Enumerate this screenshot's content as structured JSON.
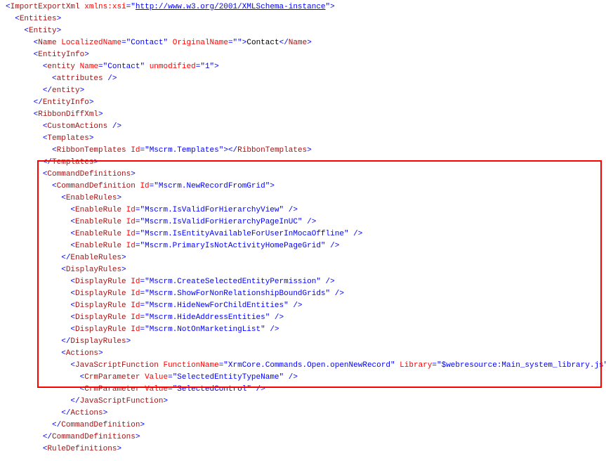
{
  "root": {
    "tag": "ImportExportXml",
    "attrs": [
      [
        "xmlns:xsi",
        "http://www.w3.org/2001/XMLSchema-instance"
      ]
    ]
  },
  "entities_tag": {
    "tag": "Entities"
  },
  "entity_tag": {
    "tag": "Entity"
  },
  "name": {
    "tag": "Name",
    "attrs": [
      [
        "LocalizedName",
        "Contact"
      ],
      [
        "OriginalName",
        ""
      ]
    ],
    "text": "Contact"
  },
  "entityinfo_tag": {
    "tag": "EntityInfo"
  },
  "entity_inner": {
    "tag": "entity",
    "attrs": [
      [
        "Name",
        "Contact"
      ],
      [
        "unmodified",
        "1"
      ]
    ]
  },
  "attributes_tag": {
    "tag": "attributes"
  },
  "ribbon_tag": {
    "tag": "RibbonDiffXml"
  },
  "custom_tag": {
    "tag": "CustomActions"
  },
  "templates_tag": {
    "tag": "Templates"
  },
  "ribbontemplates": {
    "tag": "RibbonTemplates",
    "attrs": [
      [
        "Id",
        "Mscrm.Templates"
      ]
    ]
  },
  "cmddefs_tag": {
    "tag": "CommandDefinitions"
  },
  "cmddef": {
    "tag": "CommandDefinition",
    "attrs": [
      [
        "Id",
        "Mscrm.NewRecordFromGrid"
      ]
    ]
  },
  "enablerules_tag": {
    "tag": "EnableRules"
  },
  "enable_rules": [
    {
      "tag": "EnableRule",
      "attrs": [
        [
          "Id",
          "Mscrm.IsValidForHierarchyView"
        ]
      ]
    },
    {
      "tag": "EnableRule",
      "attrs": [
        [
          "Id",
          "Mscrm.IsValidForHierarchyPageInUC"
        ]
      ]
    },
    {
      "tag": "EnableRule",
      "attrs": [
        [
          "Id",
          "Mscrm.IsEntityAvailableForUserInMocaOffline"
        ]
      ]
    },
    {
      "tag": "EnableRule",
      "attrs": [
        [
          "Id",
          "Mscrm.PrimaryIsNotActivityHomePageGrid"
        ]
      ]
    }
  ],
  "displayrules_tag": {
    "tag": "DisplayRules"
  },
  "display_rules": [
    {
      "tag": "DisplayRule",
      "attrs": [
        [
          "Id",
          "Mscrm.CreateSelectedEntityPermission"
        ]
      ]
    },
    {
      "tag": "DisplayRule",
      "attrs": [
        [
          "Id",
          "Mscrm.ShowForNonRelationshipBoundGrids"
        ]
      ]
    },
    {
      "tag": "DisplayRule",
      "attrs": [
        [
          "Id",
          "Mscrm.HideNewForChildEntities"
        ]
      ]
    },
    {
      "tag": "DisplayRule",
      "attrs": [
        [
          "Id",
          "Mscrm.HideAddressEntities"
        ]
      ]
    },
    {
      "tag": "DisplayRule",
      "attrs": [
        [
          "Id",
          "Mscrm.NotOnMarketingList"
        ]
      ]
    }
  ],
  "actions_tag": {
    "tag": "Actions"
  },
  "jsfunc": {
    "tag": "JavaScriptFunction",
    "attrs": [
      [
        "FunctionName",
        "XrmCore.Commands.Open.openNewRecord"
      ],
      [
        "Library",
        "$webresource:Main_system_library.js"
      ]
    ]
  },
  "crmparams": [
    {
      "tag": "CrmParameter",
      "attrs": [
        [
          "Value",
          "SelectedEntityTypeName"
        ]
      ]
    },
    {
      "tag": "CrmParameter",
      "attrs": [
        [
          "Value",
          "SelectedControl"
        ]
      ]
    }
  ],
  "ruledefs_tag": {
    "tag": "RuleDefinitions"
  }
}
